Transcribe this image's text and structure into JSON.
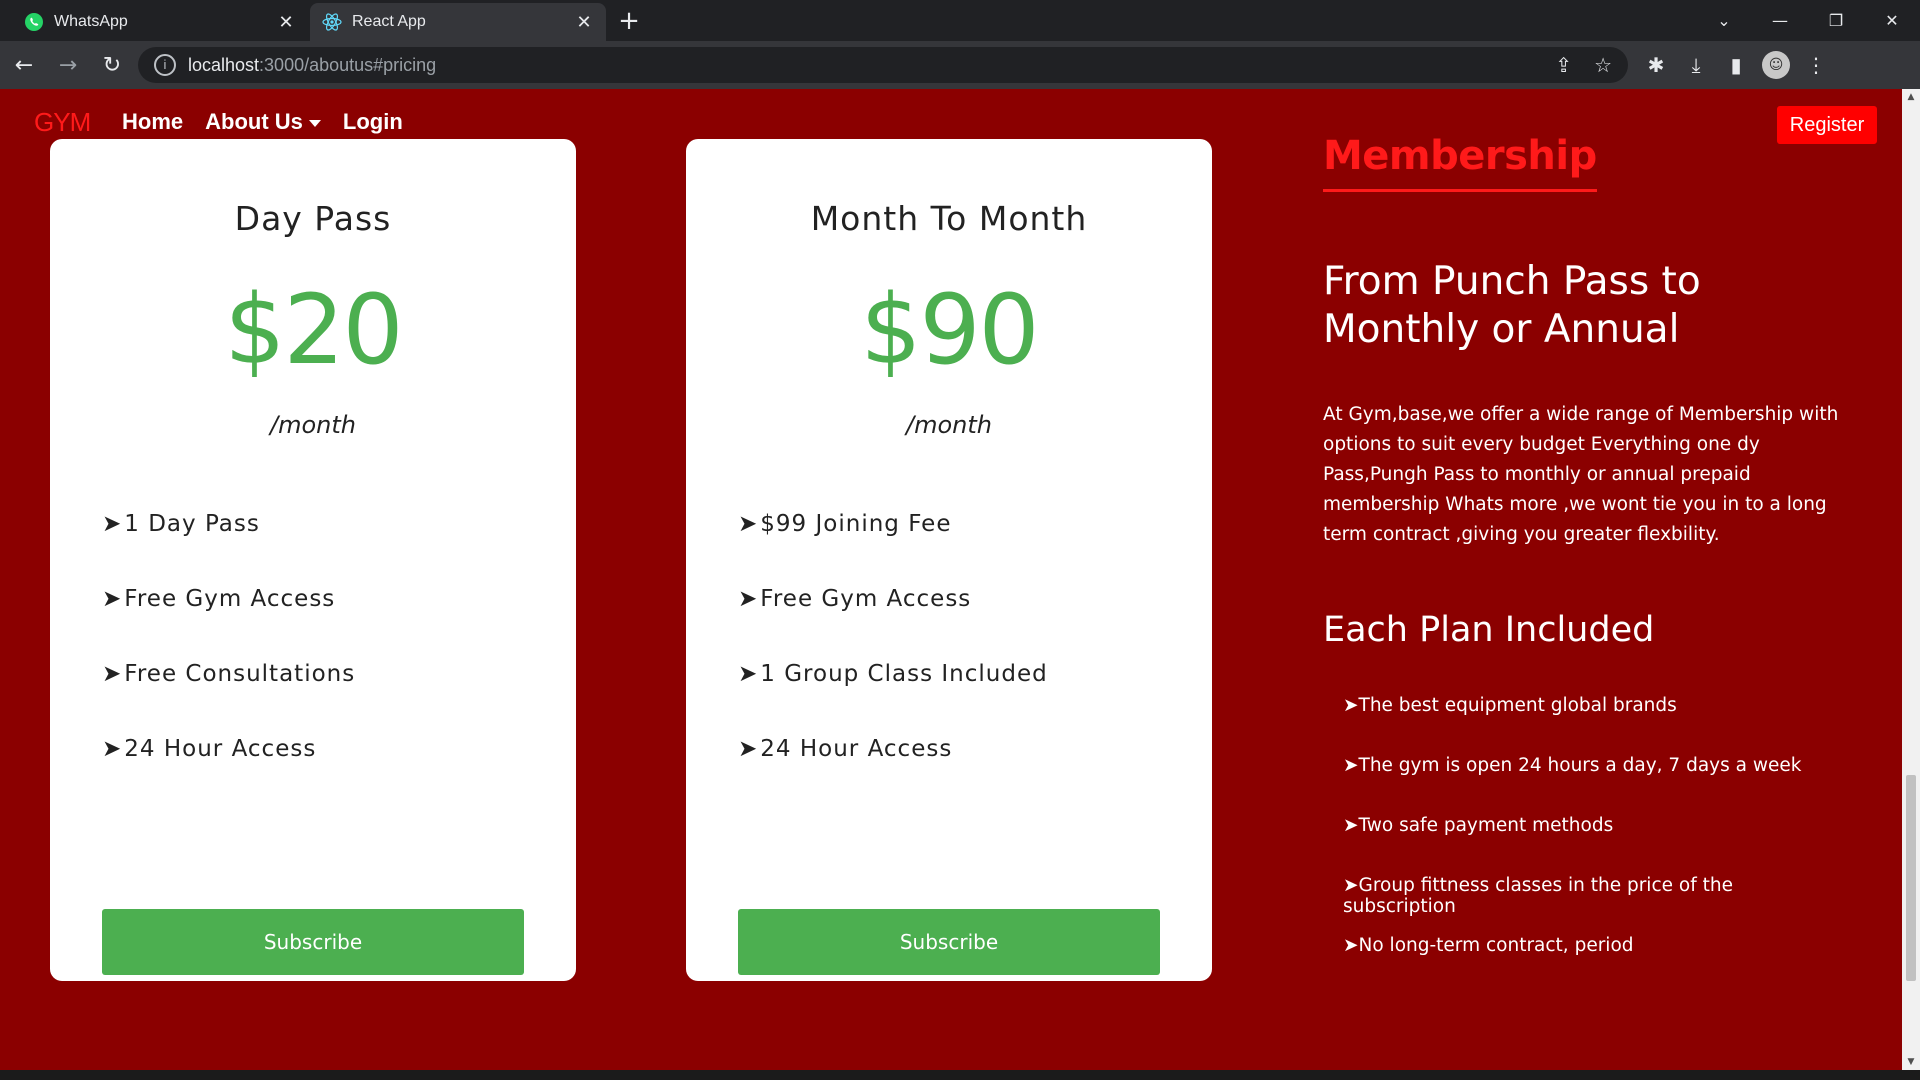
{
  "browser": {
    "tabs": [
      {
        "title": "WhatsApp",
        "icon": "whatsapp-icon",
        "active": false
      },
      {
        "title": "React App",
        "icon": "react-icon",
        "active": true
      }
    ],
    "url_host": "localhost",
    "url_path": ":3000/aboutus#pricing"
  },
  "nav": {
    "brand": "GYM",
    "items": [
      "Home",
      "About Us",
      "Login"
    ],
    "register": "Register"
  },
  "plans": [
    {
      "name": "Day Pass",
      "price": "$20",
      "period": "/month",
      "features": [
        "1 Day Pass",
        "Free Gym Access",
        "Free Consultations",
        "24 Hour Access"
      ],
      "button": "Subscribe"
    },
    {
      "name": "Month To Month",
      "price": "$90",
      "period": "/month",
      "features": [
        "$99 Joining Fee",
        "Free Gym Access",
        "1 Group Class Included",
        "24 Hour Access"
      ],
      "button": "Subscribe"
    }
  ],
  "membership": {
    "title": "Membership",
    "headline": "From Punch Pass to Monthly or Annual",
    "description": "At Gym,base,we offer a wide range of Membership with options to suit every budget Everything one dy Pass,Pungh Pass to monthly or annual prepaid membership Whats more ,we wont tie you in to a long term contract ,giving you greater flexbility.",
    "plan_heading": "Each Plan Included",
    "included": [
      "The best equipment global brands",
      "The gym is open 24 hours a day, 7 days a week",
      "Two safe payment methods",
      "Group fittness classes in the price of the subscription",
      "No long-term contract, period"
    ]
  },
  "colors": {
    "page_bg": "#8b0000",
    "accent_red": "#ff1a1a",
    "price_green": "#4caf50"
  },
  "arrow": "➤"
}
